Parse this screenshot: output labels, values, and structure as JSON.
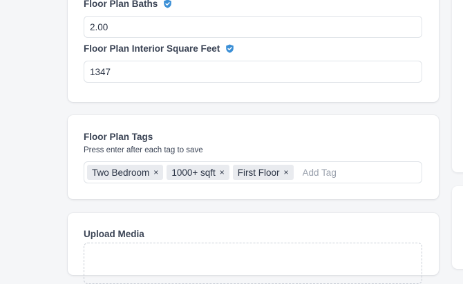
{
  "details": {
    "baths": {
      "label": "Floor Plan Baths",
      "value": "2.00",
      "icon": "verified-shield-icon"
    },
    "interior_sqft": {
      "label": "Floor Plan Interior Square Feet",
      "value": "1347",
      "icon": "verified-shield-icon"
    }
  },
  "tags": {
    "title": "Floor Plan Tags",
    "helper": "Press enter after each tag to save",
    "items": [
      {
        "label": "Two Bedroom",
        "remove": "×"
      },
      {
        "label": "1000+ sqft",
        "remove": "×"
      },
      {
        "label": "First Floor",
        "remove": "×"
      }
    ],
    "placeholder": "Add Tag"
  },
  "media": {
    "title": "Upload Media"
  },
  "colors": {
    "page_background": "#f5f6f8",
    "card_background": "#ffffff",
    "verified_icon": "#3b8fd6",
    "chip_background": "#e9ebef",
    "border": "#dfe3e8"
  }
}
